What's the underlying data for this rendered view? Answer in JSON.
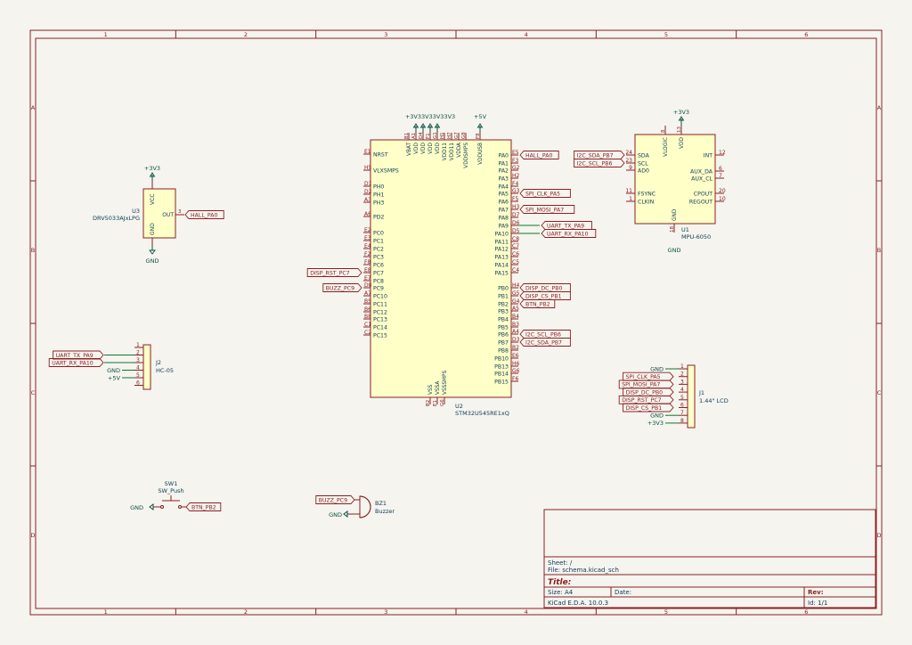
{
  "frame": {
    "cols": [
      "1",
      "2",
      "3",
      "4",
      "5",
      "6"
    ],
    "rows": [
      "A",
      "B",
      "C",
      "D"
    ]
  },
  "title_block": {
    "sheet": "Sheet: /",
    "file": "File: schema.kicad_sch",
    "title": "Title:",
    "size": "Size: A4",
    "date": "Date:",
    "rev": "Rev:",
    "tool": "KiCad E.D.A. 10.0.3",
    "id": "Id: 1/1"
  },
  "u2": {
    "ref": "U2",
    "value": "STM32U545RE1xQ",
    "left_pins": [
      {
        "num": "E1",
        "name": "NRST"
      },
      {
        "num": "H5",
        "name": "VLXSMPS"
      },
      {
        "num": "D1",
        "name": "PH0"
      },
      {
        "num": "D2",
        "name": "PH1"
      },
      {
        "num": "A3",
        "name": "PH3"
      },
      {
        "num": "A6",
        "name": "PD2"
      },
      {
        "num": "E2",
        "name": "PC0"
      },
      {
        "num": "E3",
        "name": "PC1"
      },
      {
        "num": "E4",
        "name": "PC2"
      },
      {
        "num": "F2",
        "name": "PC3"
      },
      {
        "num": "F8",
        "name": "PC6"
      },
      {
        "num": "E8",
        "name": "PC7"
      },
      {
        "num": "E7",
        "name": "PC8"
      },
      {
        "num": "D8",
        "name": "PC9"
      },
      {
        "num": "A7",
        "name": "PC10"
      },
      {
        "num": "B5",
        "name": "PC11"
      },
      {
        "num": "B6",
        "name": "PC12"
      },
      {
        "num": "B8",
        "name": "PC13"
      },
      {
        "num": "C1",
        "name": "PC14"
      },
      {
        "num": "C2",
        "name": "PC15"
      }
    ],
    "right_pins": [
      {
        "num": "E5",
        "name": "PA0"
      },
      {
        "num": "F3",
        "name": "PA1"
      },
      {
        "num": "G2",
        "name": "PA2"
      },
      {
        "num": "H2",
        "name": "PA3"
      },
      {
        "num": "F4",
        "name": "PA4"
      },
      {
        "num": "G3",
        "name": "PA5"
      },
      {
        "num": "F5",
        "name": "PA6"
      },
      {
        "num": "H3",
        "name": "PA7"
      },
      {
        "num": "D7",
        "name": "PA8"
      },
      {
        "num": "D6",
        "name": "PA9"
      },
      {
        "num": "D5",
        "name": "PA10"
      },
      {
        "num": "C8",
        "name": "PA11"
      },
      {
        "num": "C7",
        "name": "PA12"
      },
      {
        "num": "C6",
        "name": "PA13"
      },
      {
        "num": "C5",
        "name": "PA14"
      },
      {
        "num": "C4",
        "name": "PA15"
      },
      {
        "num": "H4",
        "name": "PB0"
      },
      {
        "num": "G5",
        "name": "PB1"
      },
      {
        "num": "G4",
        "name": "PB2"
      },
      {
        "num": "A5",
        "name": "PB3"
      },
      {
        "num": "B4",
        "name": "PB4"
      },
      {
        "num": "B3",
        "name": "PB5"
      },
      {
        "num": "A4",
        "name": "PB6"
      },
      {
        "num": "D3",
        "name": "PB7"
      },
      {
        "num": "B2",
        "name": "PB8"
      },
      {
        "num": "E6",
        "name": "PB10"
      },
      {
        "num": "H6",
        "name": "PB13"
      },
      {
        "num": "G6",
        "name": "PB14"
      },
      {
        "num": "F6",
        "name": "PB15"
      }
    ],
    "top_pins": [
      {
        "num": "B1",
        "name": "VBAT"
      },
      {
        "num": "A1",
        "name": "VDD"
      },
      {
        "num": "D4",
        "name": "VDD"
      },
      {
        "num": "F1",
        "name": "VDD"
      },
      {
        "num": "G1",
        "name": "VDD"
      },
      {
        "num": "H1",
        "name": "VDD11"
      },
      {
        "num": "H7",
        "name": "VDD11"
      },
      {
        "num": "G7",
        "name": "VDDA"
      },
      {
        "num": "G8",
        "name": "VDDSMPS"
      },
      {
        "num": "F8",
        "name": "VDDUSB"
      }
    ],
    "bottom_pins": [
      {
        "num": "B2",
        "name": "VSS"
      },
      {
        "num": "E1",
        "name": "VSSA"
      },
      {
        "num": "G6",
        "name": "VSSSMPS"
      }
    ],
    "labels": {
      "PA0": "HALL_PA0",
      "PA5": "SPI_CLK_PA5",
      "PA7": "SPI_MOSI_PA7",
      "PA9": "UART_TX_PA9",
      "PA10": "UART_RX_PA10",
      "PB0": "DISP_DC_PB0",
      "PB1": "DISP_CS_PB1",
      "PB2": "BTN_PB2",
      "PB6": "I2C_SCL_PB6",
      "PB7": "I2C_SDA_PB7",
      "PC7": "DISP_RST_PC7",
      "PC9": "BUZZ_PC9"
    },
    "power_labels": [
      "+3V3",
      "+3V3",
      "+3V3",
      "+3V3",
      "+5V"
    ]
  },
  "u3": {
    "ref": "U3",
    "value": "DRV5033AJxLPG",
    "vcc_pin": "VCC",
    "gnd_pin": "GND",
    "out_pin": "OUT",
    "out_num": "3",
    "vcc_num": "1",
    "gnd_num": "2",
    "power": "+3V3",
    "ground": "GND",
    "label": "HALL_PA0"
  },
  "u1": {
    "ref": "U1",
    "value": "MPU-6050",
    "left_pins": [
      {
        "num": "24",
        "name": "SDA"
      },
      {
        "num": "23",
        "name": "SCL"
      },
      {
        "num": "9",
        "name": "AD0"
      },
      {
        "num": "11",
        "name": "FSYNC"
      },
      {
        "num": "1",
        "name": "CLKIN"
      }
    ],
    "right_pins": [
      {
        "num": "12",
        "name": "INT"
      },
      {
        "num": "6",
        "name": "AUX_DA"
      },
      {
        "num": "7",
        "name": "AUX_CL"
      },
      {
        "num": "20",
        "name": "CPOUT"
      },
      {
        "num": "10",
        "name": "REGOUT"
      }
    ],
    "top_pins": [
      {
        "num": "8",
        "name": "VLOGIC"
      },
      {
        "num": "13",
        "name": "VDD"
      }
    ],
    "gnd_pin": {
      "num": "18",
      "name": "GND"
    },
    "labels": {
      "SDA": "I2C_SDA_PB7",
      "SCL": "I2C_SCL_PB6"
    },
    "power": "+3V3",
    "ground": "GND"
  },
  "j2": {
    "ref": "J2",
    "value": "HC-05",
    "pins": [
      "1",
      "2",
      "3",
      "4",
      "5",
      "6"
    ],
    "labels": [
      "",
      "UART_TX_PA9",
      "UART_RX_PA10",
      "GND",
      "+5V",
      ""
    ]
  },
  "j1": {
    "ref": "J1",
    "value": "1.44\" LCD",
    "pins": [
      "1",
      "2",
      "3",
      "4",
      "5",
      "6",
      "7",
      "8"
    ],
    "labels": [
      "GND",
      "SPI_CLK_PA5",
      "SPI_MOSI_PA7",
      "DISP_DC_PB0",
      "DISP_RST_PC7",
      "DISP_CS_PB1",
      "GND",
      "+3V3"
    ]
  },
  "sw1": {
    "ref": "SW1",
    "value": "SW_Push",
    "ground": "GND",
    "label": "BTN_PB2"
  },
  "bz1": {
    "ref": "BZ1",
    "value": "Buzzer",
    "label": "BUZZ_PC9",
    "ground": "GND"
  },
  "colors": {
    "frame": "#8b2020",
    "body": "#ffffc8",
    "power": "#0b5040",
    "pin": "#8b2020",
    "wire": "#0b7a2a",
    "text": "#0b3b54",
    "label": "#8b2020"
  }
}
